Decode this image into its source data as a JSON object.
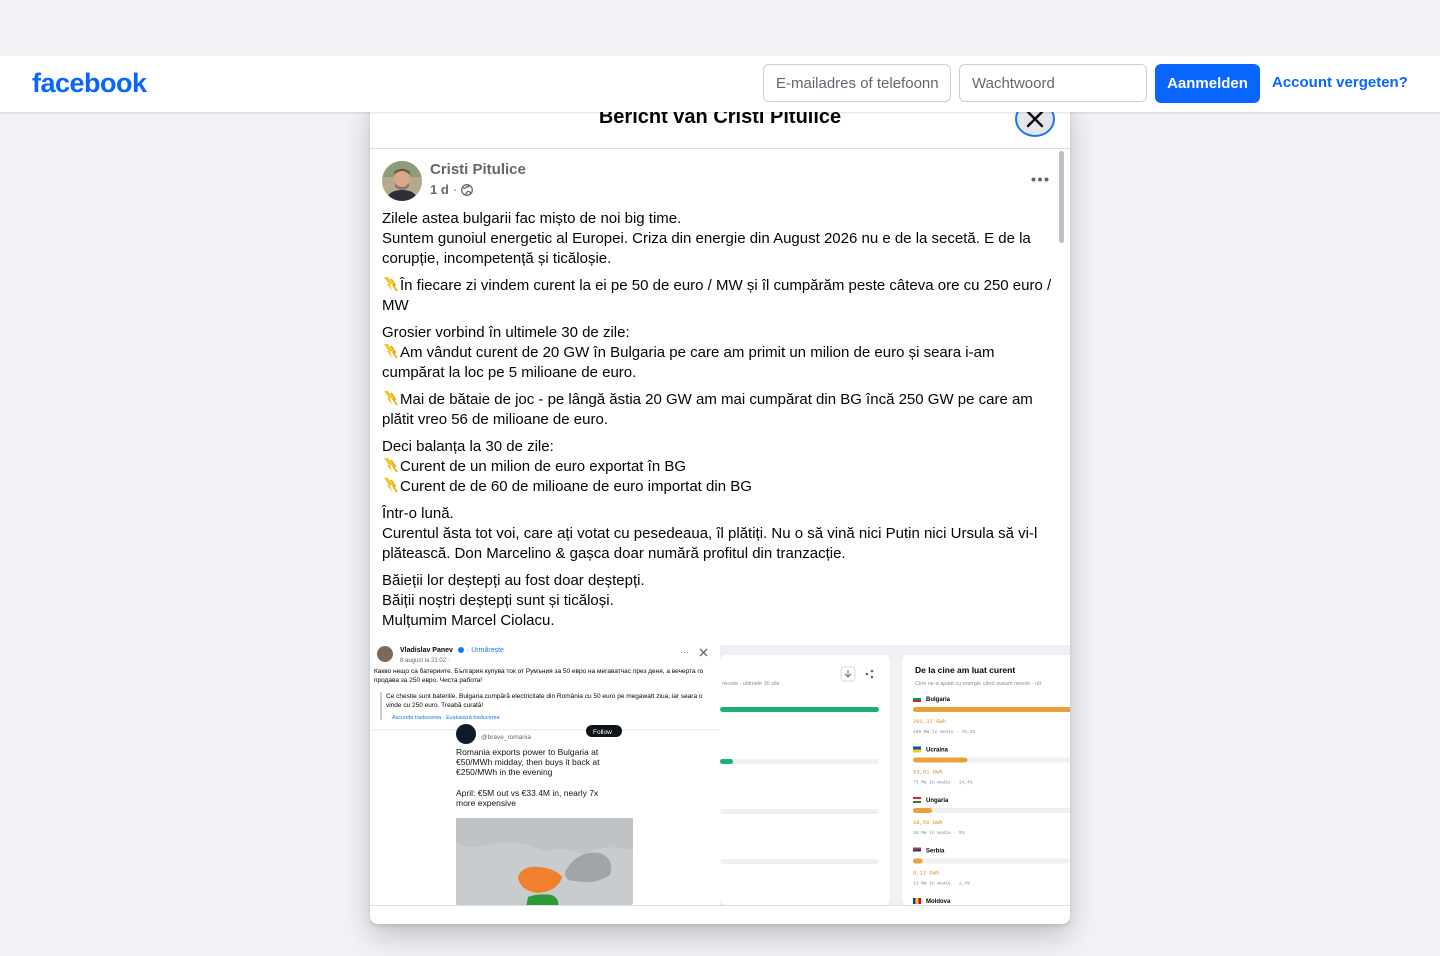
{
  "topbar": {
    "logo": "facebook",
    "email_placeholder": "E-mailadres of telefoonnummer",
    "password_placeholder": "Wachtwoord",
    "login_label": "Aanmelden",
    "forgot_label": "Account vergeten?"
  },
  "modal": {
    "title": "Bericht van Cristi Pitulice"
  },
  "post": {
    "author": "Cristi Pitulice",
    "time": "1 d",
    "separator": "·",
    "paragraphs": [
      [
        "Zilele astea bulgarii fac mișto de noi big time.",
        "Suntem gunoiul energetic al Europei. Criza din energie din August 2026 nu e de la secetă. E de la corupție, incompetență și ticăloșie."
      ],
      [
        "În fiecare zi vindem curent la ei pe 50 de euro / MW și îl cumpărăm peste câteva ore cu 250 euro / MW"
      ],
      [
        "Grosier vorbind în ultimele 30 de zile:",
        "Am vândut curent de 20 GW în Bulgaria pe care am primit un milion de euro și seara i-am cumpărat la loc pe 5 milioane de euro."
      ],
      [
        "Mai de bătaie de joc - pe lângă ăstia 20 GW am mai cumpărat din BG  încă 250 GW pe care am plătit vreo 56 de milioane de euro."
      ],
      [
        "Deci balanța la 30 de zile:",
        "Curent de un milion de euro exportat în BG",
        "Curent de de 60 de milioane de euro importat din BG"
      ],
      [
        "Într-o lună.",
        "Curentul ăsta tot voi, care ați votat cu pesedeaua, îl plătiți. Nu o să vină nici Putin nici Ursula să vi-l plătească.  Don Marcelino & gașca doar numără profitul din tranzacție."
      ],
      [
        "Băieții lor deștepți au fost doar deștepți.",
        "Băiții noștri deștepți sunt și ticăloși.",
        "Mulțumim Marcel Ciolacu."
      ]
    ]
  },
  "attachment": {
    "embed_author": "Vladislav Panev",
    "embed_follow": "· Urmărește",
    "embed_date": "8 august la 21:02 ·",
    "embed_text": "Какво нещо са батериите. България купува ток от Румъния за 50 евро на мегаватчас през деня, а вечерта го продава за 250 евро. Чиста работа!",
    "embed_translation": "Ce chestie sunt bateriile. Bulgaria cumpără electricitate din România cu 50 euro pe megawatt ziua, iar seara o vinde cu 250 euro. Treabă curată!",
    "embed_translation_links": "Ascunde traducerea · Evaluează traducerea",
    "tweet_handle": "@brave_romania",
    "tweet_follow": "Follow",
    "tweet_line1": "Romania exports power to Bulgaria at",
    "tweet_line2": "€50/MWh midday, then buys it back at",
    "tweet_line3": "€250/MWh in the evening",
    "tweet_line4": "April: €5M out vs €33.4M in, nearly 7x",
    "tweet_line5": "more expensive",
    "panel_sub": "nevoie - ultimele 30 zile",
    "right_title": "De la cine am luat curent",
    "right_sub": "Cine ne-a ajutat cu energie când aveam nevoie - ult",
    "countries": [
      {
        "name": "Bulgaria",
        "value": "292,37 GWh",
        "detail": "408 MW în medie · 78,2%",
        "fill": 1.0
      },
      {
        "name": "Ucraina",
        "value": "53,81 GWh",
        "detail": "75 MW în medie · 14,4%",
        "fill": 0.34
      },
      {
        "name": "Ungaria",
        "value": "18,56 GWh",
        "detail": "26 MW în medie · 5%",
        "fill": 0.12
      },
      {
        "name": "Serbia",
        "value": "9,12 GWh",
        "detail": "13 MW în medie · 2,4%",
        "fill": 0.06
      },
      {
        "name": "Moldova",
        "value": "",
        "detail": "",
        "fill": 0.0
      }
    ],
    "colors": {
      "bar_orange": "#e8a33a",
      "bar_green": "#1fae74",
      "value_orange": "#e38b2c",
      "romania": "#f07f2e",
      "bulgaria": "#2f9a3a"
    }
  },
  "colors": {
    "brand": "#0866ff",
    "page_bg": "#f0f2f5"
  }
}
